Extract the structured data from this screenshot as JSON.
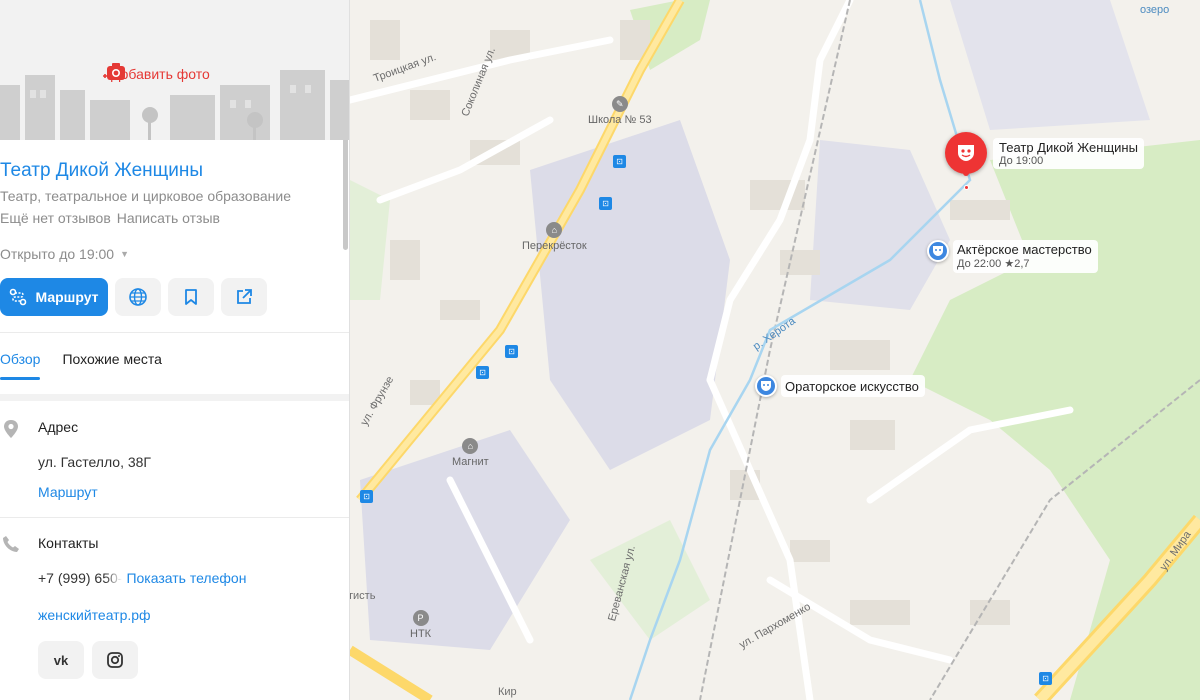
{
  "panel": {
    "add_photo": "Добавить фото",
    "title": "Театр Дикой Женщины",
    "category": "Театр, театральное и цирковое образование",
    "no_reviews": "Ещё нет отзывов",
    "write_review": "Написать отзыв",
    "hours": "Открыто до 19:00",
    "route_label": "Маршрут",
    "tabs": [
      {
        "label": "Обзор",
        "active": true
      },
      {
        "label": "Похожие места",
        "active": false
      }
    ],
    "address": {
      "title": "Адрес",
      "value": "ул. Гастелло, 38Г",
      "route_link": "Маршрут"
    },
    "contacts": {
      "title": "Контакты",
      "phone_partial": "+7 (999) 650-",
      "show_phone": "Показать телефон",
      "website": "женскийтеатр.рф"
    },
    "social": [
      "vk-icon",
      "instagram-icon"
    ],
    "icons": [
      "camera-icon",
      "route-icon",
      "globe-icon",
      "bookmark-icon",
      "share-icon",
      "location-pin-icon",
      "phone-icon",
      "caret-down-icon"
    ]
  },
  "map": {
    "street_labels": {
      "troitskaya": "Троицкая ул.",
      "sokolinaya": "Соколиная ул.",
      "frunze": "ул. Фрунзе",
      "erevanskaya": "Ереванская ул.",
      "parkhomenko": "ул. Пархоменко",
      "mira": "ул. Мира",
      "river": "р. Херота",
      "lake": "озеро",
      "dentistry": "тисть",
      "kir": "Кир"
    },
    "pois": {
      "school": "Школа № 53",
      "perekrestok": "Перекрёсток",
      "magnit": "Магнит",
      "ntk": "НТК"
    },
    "places": {
      "main": {
        "name": "Театр Дикой Женщины",
        "sub": "До 19:00"
      },
      "acting": {
        "name": "Актёрское мастерство",
        "sub": "До 22:00",
        "rating": "★2,7"
      },
      "oratory": {
        "name": "Ораторское искусство"
      }
    },
    "colors": {
      "accent": "#1e88e5",
      "pin_red": "#ee3434",
      "road_yellow": "#ffe082",
      "park_green": "#d7ecc4",
      "industrial": "#dcdce8"
    }
  }
}
